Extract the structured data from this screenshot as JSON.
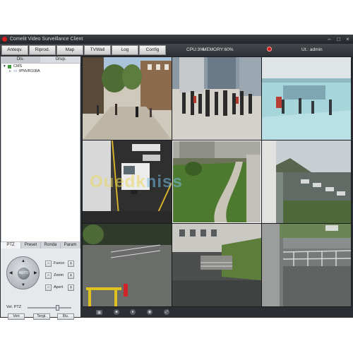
{
  "window": {
    "title": "Comelit Video Surveillance Client"
  },
  "toolbar": {
    "buttons": [
      "Anteqv.",
      "Riprod.",
      "Map",
      "TVWall",
      "Log",
      "Config"
    ],
    "cpu": "CPU:3%",
    "memory": "MEMORY:60%",
    "user": "Ut.: admin"
  },
  "left_panel": {
    "tabs": [
      "Dis.",
      "Grup."
    ],
    "tree": {
      "root": "CMS",
      "child": "IPNVR108A"
    },
    "ptz_tabs": [
      "PTZ",
      "Preset",
      "Ronda",
      "Param"
    ],
    "joystick_label": "AUTO",
    "controls": [
      "Fuoco",
      "Zoom",
      "Apert"
    ],
    "speed_label": "Vel. PTZ",
    "speed_level_percent": 70,
    "bottom_buttons": [
      "Ven",
      "Tergi.",
      "Illu."
    ]
  },
  "camera_grid": {
    "layout": "3x3",
    "selected_tile": 5,
    "tiles": [
      "camera-street-crowd",
      "camera-pedestrians-plaza",
      "camera-station-concourse",
      "camera-parking-van",
      "camera-garden-path",
      "camera-parking-lot",
      "camera-wet-yard",
      "camera-courtyard",
      "camera-parking-railing"
    ]
  },
  "watermark": {
    "part1": "Ouedk",
    "part2": "niss"
  },
  "colors": {
    "accent_red": "#d11e1e",
    "window_dark": "#2a2d31",
    "panel_light": "#eef0f2"
  }
}
